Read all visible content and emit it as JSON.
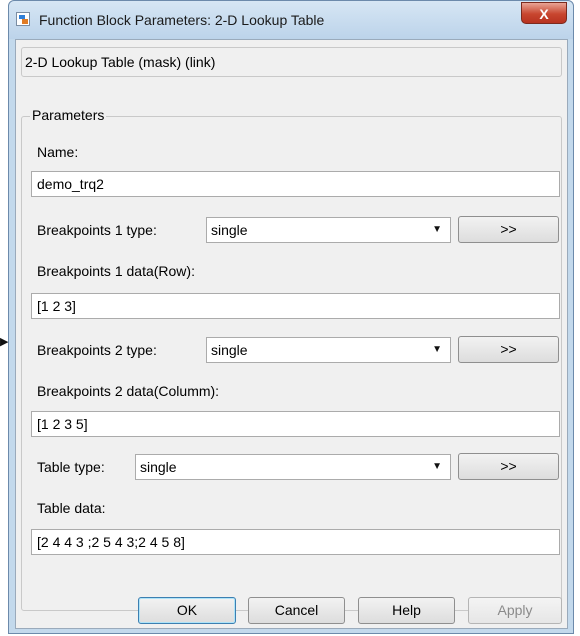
{
  "window": {
    "title": "Function Block Parameters: 2-D Lookup Table",
    "close_label": "X"
  },
  "mask": {
    "header": "2-D Lookup Table (mask) (link)"
  },
  "parameters": {
    "group_label": "Parameters",
    "name_label": "Name:",
    "name_value": "demo_trq2",
    "bp1_type_label": "Breakpoints 1 type:",
    "bp1_type_value": "single",
    "bp1_data_label": "Breakpoints 1 data(Row):",
    "bp1_data_value": "[1 2 3]",
    "bp2_type_label": "Breakpoints 2 type:",
    "bp2_type_value": "single",
    "bp2_data_label": "Breakpoints 2 data(Columm):",
    "bp2_data_value": "[1 2 3 5]",
    "table_type_label": "Table type:",
    "table_type_value": "single",
    "table_data_label": "Table data:",
    "table_data_value": "[2 4 4 3 ;2 5 4 3;2 4 5 8]",
    "expand_label": ">>"
  },
  "buttons": {
    "ok": "OK",
    "cancel": "Cancel",
    "help": "Help",
    "apply": "Apply"
  },
  "icons": {
    "dropdown": "chevron-down-icon",
    "app": "simulink-icon",
    "external_arrow": "triangle-right-icon"
  }
}
